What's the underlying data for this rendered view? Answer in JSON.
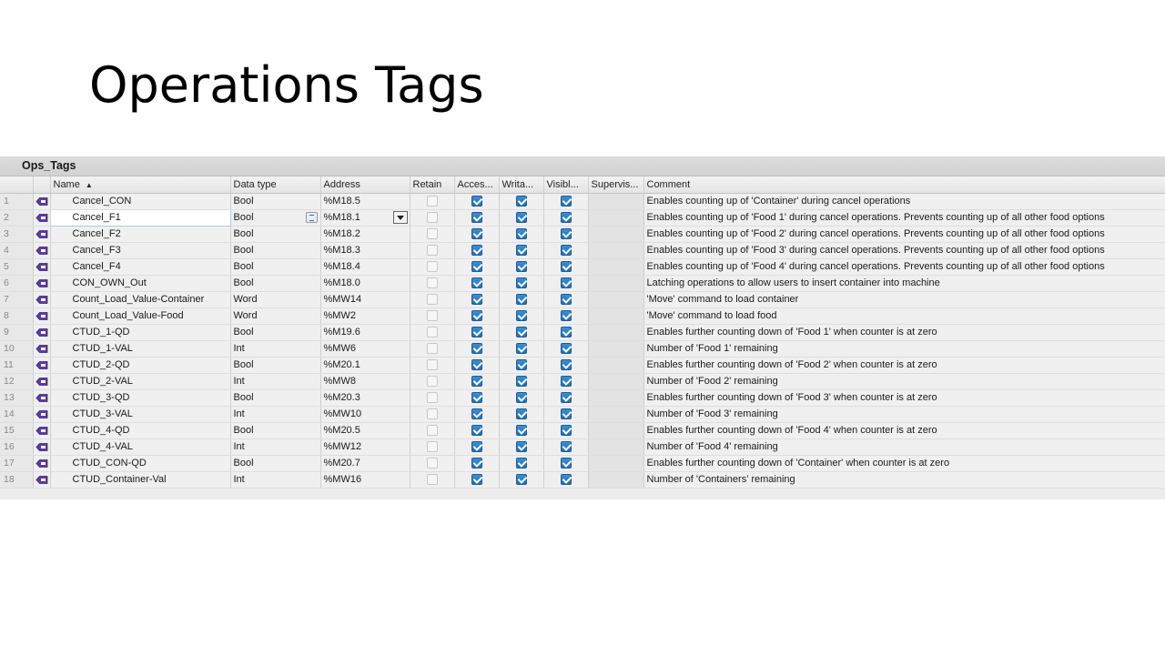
{
  "slide": {
    "title": "Operations Tags"
  },
  "table": {
    "panel_title": "Ops_Tags",
    "columns": {
      "name": "Name",
      "sort_indicator": "▲",
      "data_type": "Data type",
      "address": "Address",
      "retain": "Retain",
      "accessible": "Acces...",
      "writable": "Writa...",
      "visible": "Visibl...",
      "supervision": "Supervis...",
      "comment": "Comment"
    },
    "rows": [
      {
        "n": "1",
        "name": "Cancel_CON",
        "type": "Bool",
        "addr": "%M18.5",
        "retain": false,
        "acc": true,
        "wri": true,
        "vis": true,
        "comment": "Enables counting up of 'Container' during cancel operations"
      },
      {
        "n": "2",
        "name": "Cancel_F1",
        "type": "Bool",
        "addr": "%M18.1",
        "retain": false,
        "acc": true,
        "wri": true,
        "vis": true,
        "comment": "Enables counting up of 'Food 1' during cancel operations. Prevents counting up of all other food options"
      },
      {
        "n": "3",
        "name": "Cancel_F2",
        "type": "Bool",
        "addr": "%M18.2",
        "retain": false,
        "acc": true,
        "wri": true,
        "vis": true,
        "comment": "Enables counting up of 'Food 2' during cancel operations. Prevents counting up of all other food options"
      },
      {
        "n": "4",
        "name": "Cancel_F3",
        "type": "Bool",
        "addr": "%M18.3",
        "retain": false,
        "acc": true,
        "wri": true,
        "vis": true,
        "comment": "Enables counting up of 'Food 3' during cancel operations. Prevents counting up of all other food options"
      },
      {
        "n": "5",
        "name": "Cancel_F4",
        "type": "Bool",
        "addr": "%M18.4",
        "retain": false,
        "acc": true,
        "wri": true,
        "vis": true,
        "comment": "Enables counting up of 'Food 4' during cancel operations. Prevents counting up of all other food options"
      },
      {
        "n": "6",
        "name": "CON_OWN_Out",
        "type": "Bool",
        "addr": "%M18.0",
        "retain": false,
        "acc": true,
        "wri": true,
        "vis": true,
        "comment": "Latching operations to allow users to insert container into machine"
      },
      {
        "n": "7",
        "name": "Count_Load_Value-Container",
        "type": "Word",
        "addr": "%MW14",
        "retain": false,
        "acc": true,
        "wri": true,
        "vis": true,
        "comment": "'Move' command to load container"
      },
      {
        "n": "8",
        "name": "Count_Load_Value-Food",
        "type": "Word",
        "addr": "%MW2",
        "retain": false,
        "acc": true,
        "wri": true,
        "vis": true,
        "comment": "'Move' command to load food"
      },
      {
        "n": "9",
        "name": "CTUD_1-QD",
        "type": "Bool",
        "addr": "%M19.6",
        "retain": false,
        "acc": true,
        "wri": true,
        "vis": true,
        "comment": "Enables further counting down of 'Food 1' when counter is at zero"
      },
      {
        "n": "10",
        "name": "CTUD_1-VAL",
        "type": "Int",
        "addr": "%MW6",
        "retain": false,
        "acc": true,
        "wri": true,
        "vis": true,
        "comment": "Number of 'Food 1' remaining"
      },
      {
        "n": "11",
        "name": "CTUD_2-QD",
        "type": "Bool",
        "addr": "%M20.1",
        "retain": false,
        "acc": true,
        "wri": true,
        "vis": true,
        "comment": "Enables further counting down of 'Food 2' when counter is at zero"
      },
      {
        "n": "12",
        "name": "CTUD_2-VAL",
        "type": "Int",
        "addr": "%MW8",
        "retain": false,
        "acc": true,
        "wri": true,
        "vis": true,
        "comment": "Number of 'Food 2' remaining"
      },
      {
        "n": "13",
        "name": "CTUD_3-QD",
        "type": "Bool",
        "addr": "%M20.3",
        "retain": false,
        "acc": true,
        "wri": true,
        "vis": true,
        "comment": "Enables further counting down of 'Food 3' when counter is at zero"
      },
      {
        "n": "14",
        "name": "CTUD_3-VAL",
        "type": "Int",
        "addr": "%MW10",
        "retain": false,
        "acc": true,
        "wri": true,
        "vis": true,
        "comment": "Number of 'Food 3' remaining"
      },
      {
        "n": "15",
        "name": "CTUD_4-QD",
        "type": "Bool",
        "addr": "%M20.5",
        "retain": false,
        "acc": true,
        "wri": true,
        "vis": true,
        "comment": "Enables further counting down of 'Food 4' when counter is at zero"
      },
      {
        "n": "16",
        "name": "CTUD_4-VAL",
        "type": "Int",
        "addr": "%MW12",
        "retain": false,
        "acc": true,
        "wri": true,
        "vis": true,
        "comment": "Number of 'Food 4' remaining"
      },
      {
        "n": "17",
        "name": "CTUD_CON-QD",
        "type": "Bool",
        "addr": "%M20.7",
        "retain": false,
        "acc": true,
        "wri": true,
        "vis": true,
        "comment": "Enables further counting down of 'Container' when counter is at zero"
      },
      {
        "n": "18",
        "name": "CTUD_Container-Val",
        "type": "Int",
        "addr": "%MW16",
        "retain": false,
        "acc": true,
        "wri": true,
        "vis": true,
        "comment": "Number of 'Containers' remaining"
      }
    ],
    "editing_row_index": 1,
    "colors": {
      "checkbox_on": "#2a7fcc",
      "tag_icon": "#5b3aa8"
    },
    "icons": {
      "row_icon": "plc-tag-icon"
    }
  }
}
